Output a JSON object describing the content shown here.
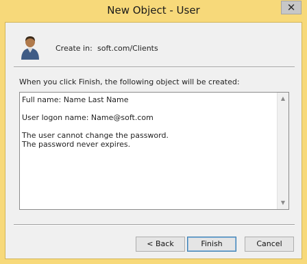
{
  "window": {
    "title": "New Object - User",
    "close_glyph": "✕",
    "accent_color": "#f7d97a"
  },
  "header": {
    "icon": "user-icon",
    "create_in_label": "Create in:",
    "create_in_value": "soft.com/Clients"
  },
  "summary": {
    "intro": "When you click Finish, the following object will be created:",
    "lines": [
      "Full name: Name Last Name",
      "",
      "User logon name: Name@soft.com",
      "",
      "The user cannot change the password.",
      "The password never expires."
    ],
    "scroll_up_glyph": "▲",
    "scroll_down_glyph": "▼"
  },
  "buttons": {
    "back": "< Back",
    "finish": "Finish",
    "cancel": "Cancel"
  }
}
